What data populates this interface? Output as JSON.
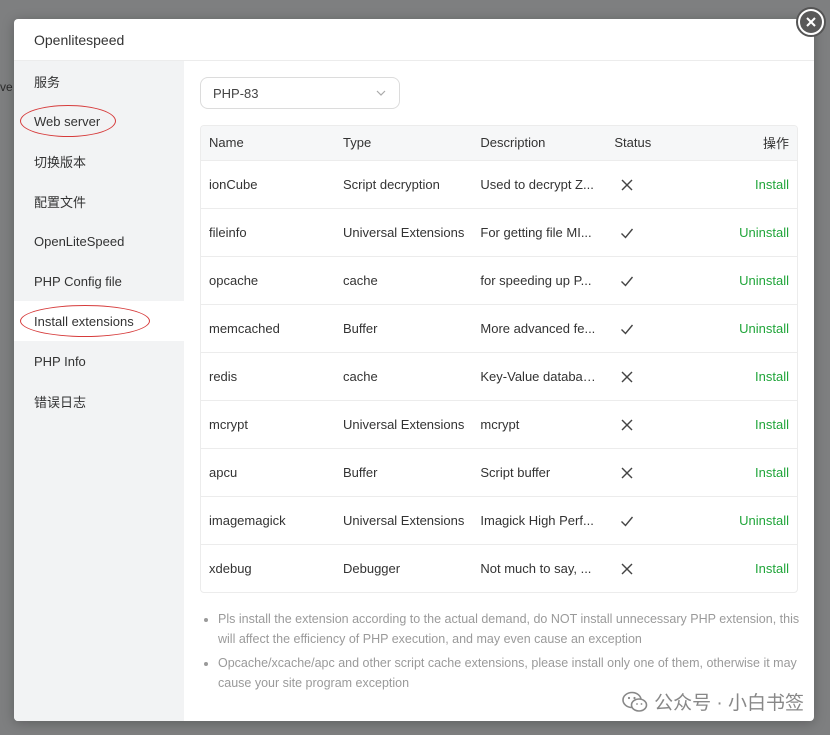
{
  "backdrop": {
    "edge_text": "ve"
  },
  "modal": {
    "title": "Openlitespeed"
  },
  "sidebar": {
    "items": [
      {
        "label": "服务",
        "active": false,
        "circled": false
      },
      {
        "label": "Web server",
        "active": false,
        "circled": true
      },
      {
        "label": "切换版本",
        "active": false,
        "circled": false
      },
      {
        "label": "配置文件",
        "active": false,
        "circled": false
      },
      {
        "label": "OpenLiteSpeed",
        "active": false,
        "circled": false
      },
      {
        "label": "PHP Config file",
        "active": false,
        "circled": false
      },
      {
        "label": "Install extensions",
        "active": true,
        "circled": true
      },
      {
        "label": "PHP Info",
        "active": false,
        "circled": false
      },
      {
        "label": "错误日志",
        "active": false,
        "circled": false
      }
    ]
  },
  "php_select": {
    "value": "PHP-83"
  },
  "table": {
    "headers": {
      "name": "Name",
      "type": "Type",
      "description": "Description",
      "status": "Status",
      "op": "操作"
    },
    "rows": [
      {
        "name": "ionCube",
        "type": "Script decryption",
        "description": "Used to decrypt Z...",
        "status": "x",
        "action": "Install"
      },
      {
        "name": "fileinfo",
        "type": "Universal Extensions",
        "description": "For getting file MI...",
        "status": "check",
        "action": "Uninstall"
      },
      {
        "name": "opcache",
        "type": "cache",
        "description": "for speeding up P...",
        "status": "check",
        "action": "Uninstall"
      },
      {
        "name": "memcached",
        "type": "Buffer",
        "description": "More advanced fe...",
        "status": "check",
        "action": "Uninstall"
      },
      {
        "name": "redis",
        "type": "cache",
        "description": "Key-Value databas...",
        "status": "x",
        "action": "Install"
      },
      {
        "name": "mcrypt",
        "type": "Universal Extensions",
        "description": "mcrypt",
        "status": "x",
        "action": "Install"
      },
      {
        "name": "apcu",
        "type": "Buffer",
        "description": "Script buffer",
        "status": "x",
        "action": "Install"
      },
      {
        "name": "imagemagick",
        "type": "Universal Extensions",
        "description": "Imagick High Perf...",
        "status": "check",
        "action": "Uninstall"
      },
      {
        "name": "xdebug",
        "type": "Debugger",
        "description": "Not much to say, ...",
        "status": "x",
        "action": "Install"
      }
    ]
  },
  "notes": [
    "Pls install the extension according to the actual demand, do NOT install unnecessary PHP extension, this will affect the efficiency of PHP execution, and may even cause an exception",
    "Opcache/xcache/apc and other script cache extensions, please install only one of them, otherwise it may cause your site program exception"
  ],
  "watermark": {
    "text": "公众号 · 小白书签"
  },
  "colors": {
    "accent": "#20a53a",
    "highlight_circle": "#d63b3b"
  }
}
